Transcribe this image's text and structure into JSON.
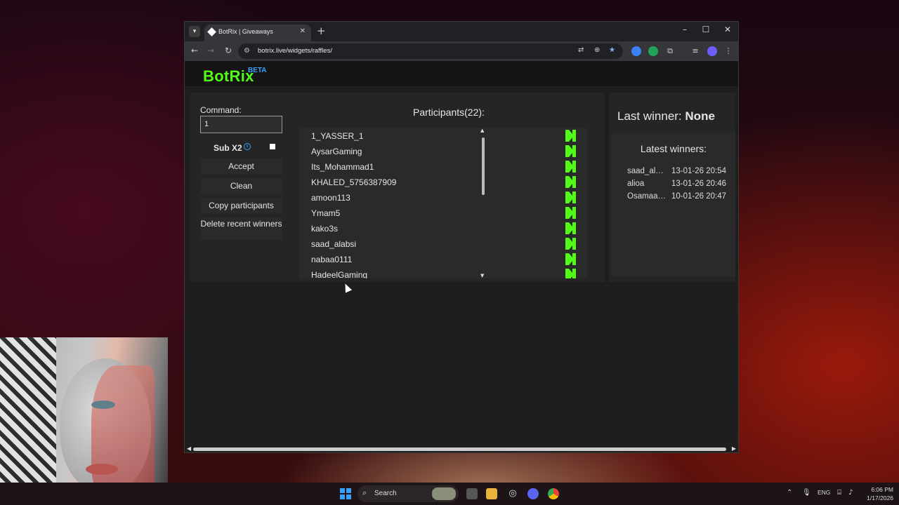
{
  "browser": {
    "tab_title": "BotRix | Giveaways",
    "url": "botrix.live/widgets/raffles/",
    "tab_list_icon": "chevron-down-icon",
    "new_tab_icon": "plus-icon",
    "window_controls": [
      "minimize-icon",
      "maximize-icon",
      "close-icon"
    ]
  },
  "site": {
    "logo": "BotRix",
    "logo_badge": "BETA"
  },
  "raffle": {
    "command_label": "Command:",
    "command_value": "1",
    "sub_label": "Sub X2",
    "sub_checked": false,
    "buttons": {
      "accept": "Accept",
      "clean": "Clean",
      "copy": "Copy participants",
      "delete": "Delete recent winners"
    },
    "participants_title": "Participants(22):",
    "participants": [
      "1_YASSER_1",
      "AysarGaming",
      "Its_Mohammad1",
      "KHALED_5756387909",
      "amoon113",
      "Ymam5",
      "kako3s",
      "saad_alabsi",
      "nabaa0111",
      "HadeelGaming"
    ],
    "platform_icon": "kick-logo-icon",
    "last_winner_label": "Last winner:",
    "last_winner_value": "None",
    "latest_title": "Latest winners:",
    "latest_winners": [
      {
        "name": "saad_alab...",
        "date": "13-01-26 20:54"
      },
      {
        "name": "alioa",
        "date": "13-01-26 20:46"
      },
      {
        "name": "Osamaax...",
        "date": "10-01-26 20:47"
      }
    ]
  },
  "taskbar": {
    "search_label": "Search",
    "language": "ENG",
    "time": "6:06 PM",
    "date": "1/17/2026"
  },
  "colors": {
    "brand": "#53fc18",
    "beta": "#3aa0ff",
    "panel": "#252525",
    "page_bg": "#1e1e1e"
  }
}
